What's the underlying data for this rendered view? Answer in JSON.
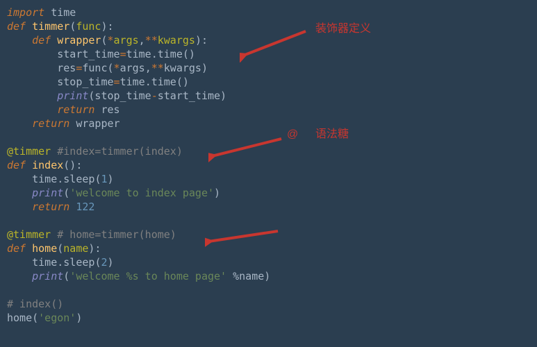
{
  "code": {
    "l01a": "import",
    "l01b": " time",
    "l02a": "def",
    "l02b": " timmer",
    "l02c": "(",
    "l02d": "func",
    "l02e": "):",
    "l03a": "    def",
    "l03b": " wrapper",
    "l03c": "(",
    "l03d": "*",
    "l03e": "args",
    "l03f": ",",
    "l03g": "**",
    "l03h": "kwargs",
    "l03i": "):",
    "l04a": "        start_time",
    "l04b": "=",
    "l04c": "time",
    "l04d": ".",
    "l04e": "time",
    "l04f": "()",
    "l05a": "        res",
    "l05b": "=",
    "l05c": "func",
    "l05d": "(",
    "l05e": "*",
    "l05f": "args",
    "l05g": ",",
    "l05h": "**",
    "l05i": "kwargs",
    "l05j": ")",
    "l06a": "        stop_time",
    "l06b": "=",
    "l06c": "time",
    "l06d": ".",
    "l06e": "time",
    "l06f": "()",
    "l07a": "        ",
    "l07b": "print",
    "l07c": "(stop_time",
    "l07d": "-",
    "l07e": "start_time)",
    "l08a": "        return",
    "l08b": " res",
    "l09a": "    return",
    "l09b": " wrapper",
    "l10": " ",
    "l11a": "@",
    "l11b": "timmer",
    "l11c": " #index=timmer(index)",
    "l12a": "def",
    "l12b": " index",
    "l12c": "():",
    "l13a": "    time",
    "l13b": ".",
    "l13c": "sleep",
    "l13d": "(",
    "l13e": "1",
    "l13f": ")",
    "l14a": "    ",
    "l14b": "print",
    "l14c": "(",
    "l14d": "'welcome to index page'",
    "l14e": ")",
    "l15a": "    return",
    "l15b": " ",
    "l15c": "122",
    "l16": " ",
    "l17a": "@",
    "l17b": "timmer",
    "l17c": " # home=timmer(home)",
    "l18a": "def",
    "l18b": " home",
    "l18c": "(",
    "l18d": "name",
    "l18e": "):",
    "l19a": "    time",
    "l19b": ".",
    "l19c": "sleep",
    "l19d": "(",
    "l19e": "2",
    "l19f": ")",
    "l20a": "    ",
    "l20b": "print",
    "l20c": "(",
    "l20d": "'welcome %s to home page'",
    "l20e": " %name)",
    "l21": " ",
    "l22": "# index()",
    "l23a": "home(",
    "l23b": "'egon'",
    "l23c": ")"
  },
  "annotations": {
    "decorator_def": "装饰器定义",
    "at_symbol": "@",
    "syntax_sugar": "语法糖"
  },
  "colors": {
    "annotation": "#c8362f",
    "background": "#2b3e50"
  }
}
